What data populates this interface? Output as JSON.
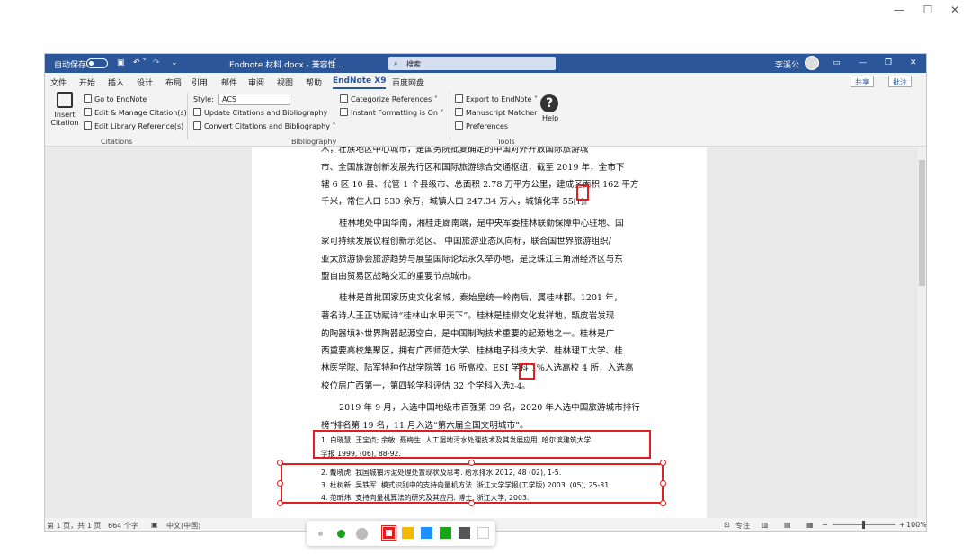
{
  "titlebar": {
    "autosave_label": "自动保存",
    "autosave_state": "关",
    "doc_title": "Endnote 材料.docx - 兼容性...",
    "search_placeholder": "搜索",
    "user": "李溪公"
  },
  "menu": {
    "items": [
      "文件",
      "开始",
      "插入",
      "设计",
      "布局",
      "引用",
      "邮件",
      "审阅",
      "视图",
      "帮助",
      "EndNote X9",
      "百度网盘"
    ],
    "share": "共享",
    "comment": "批注"
  },
  "ribbon": {
    "insert_citation": "Insert Citation",
    "citations": [
      "Go to EndNote",
      "Edit & Manage Citation(s)",
      "Edit Library Reference(s)"
    ],
    "citations_group": "Citations",
    "style_label": "Style:",
    "style_value": "ACS",
    "bib": [
      "Update Citations and Bibliography",
      "Convert Citations and Bibliography"
    ],
    "bib_group": "Bibliography",
    "categorize": "Categorize References",
    "instant": "Instant Formatting is On",
    "tools": [
      "Export to EndNote",
      "Manuscript Matcher",
      "Preferences"
    ],
    "tools_group": "Tools",
    "help": "Help"
  },
  "document": {
    "lines": [
      "木，壮族地区中心城市，是国务院批复确定的中国对外开放国际旅游城",
      "市、全国旅游创新发展先行区和国际旅游综合交通枢纽，截至 2019 年，全市下",
      "辖 6 区 10 县、代管 1 个县级市、总面积 2.78 万平方公里，建成区面积 162 平方",
      "千米，常住人口 530 余万，城镇人口 247.34 万人，城镇化率 55",
      "桂林地处中国华南，湘桂走廊南端，是中央军委桂林联勤保障中心驻地、国",
      "家可持续发展议程创新示范区、 中国旅游业态风向标，联合国世界旅游组织/",
      "亚太旅游协会旅游趋势与展望国际论坛永久举办地，是泛珠江三角洲经济区与东",
      "盟自由贸易区战略交汇的重要节点城市。",
      "桂林是首批国家历史文化名城，秦始皇统一岭南后，属桂林郡。1201 年，",
      "著名诗人王正功赋诗“桂林山水甲天下”。桂林是桂柳文化发祥地，甑皮岩发现",
      "的陶器填补世界陶器起源空白，是中国制陶技术重要的起源地之一。桂林是广",
      "西重要高校集聚区，拥有广西师范大学、桂林电子科技大学、桂林理工大学、桂",
      "林医学院、陆军特种作战学院等 16 所高校。ESI 学科 1%入选高校 4 所，入选高",
      "校位居广西第一，第四轮学科评估 32 个学科入选",
      "2019 年 9 月，入选中国地级市百强第 39 名，2020 年入选中国旅游城市排行",
      "榜”排名第 19 名，11 月入选“第六届全国文明城市”。"
    ],
    "cite1": "[1]",
    "cite2": "2-4",
    "references": [
      "1.  白晓慧;  王宝贞;  余敏; 聂梅生. 人工湿地污水处理技术及其发展应用. 哈尔滨建筑大学",
      "学报  1999,   (06), 88-92.",
      "2.  戴晓虎. 我国城镇污泥处理处置现状及思考. 给水排水  2012, 48 (02), 1-5.",
      "3.  杜树新; 吴铁军. 模式识别中的支持向量机方法. 浙江大学学报(工学版) 2003,   (05), 25-31.",
      "4.  范昕炜. 支持向量机算法的研究及其应用. 博士, 浙江大学, 2003."
    ]
  },
  "statusbar": {
    "page": "第 1 页，共 1 页",
    "words": "664 个字",
    "lang": "中文(中国)",
    "focus": "专注",
    "zoom": "100%"
  },
  "colors": {
    "accent": "#2b579a",
    "annotation": "#e02020"
  }
}
